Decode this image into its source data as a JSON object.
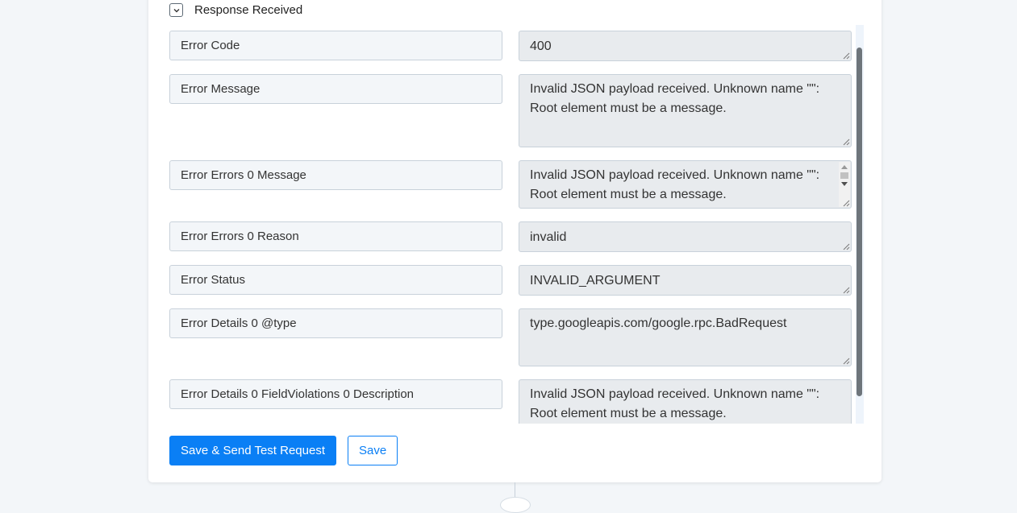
{
  "section": {
    "title": "Response Received",
    "toggle_icon": "chevron-down-icon"
  },
  "fields": [
    {
      "label": "Error Code",
      "value": "400"
    },
    {
      "label": "Error Message",
      "value": "Invalid JSON payload received. Unknown name \"\": Root element must be a message."
    },
    {
      "label": "Error Errors 0 Message",
      "value": "Invalid JSON payload received. Unknown name \"\": Root element must be a message."
    },
    {
      "label": "Error Errors 0 Reason",
      "value": "invalid"
    },
    {
      "label": "Error Status",
      "value": "INVALID_ARGUMENT"
    },
    {
      "label": "Error Details 0 @type",
      "value": "type.googleapis.com/google.rpc.BadRequest"
    },
    {
      "label": "Error Details 0 FieldViolations 0 Description",
      "value": "Invalid JSON payload received. Unknown name \"\": Root element must be a message."
    }
  ],
  "buttons": {
    "save_send": "Save & Send Test Request",
    "save": "Save"
  },
  "colors": {
    "accent": "#0a7ff5",
    "label_bg": "#f3f6f9",
    "value_bg": "#e8ebee"
  }
}
